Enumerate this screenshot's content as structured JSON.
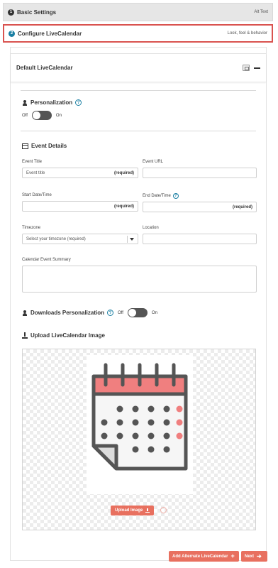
{
  "steps": [
    {
      "number": "1",
      "title": "Basic Settings",
      "right": "Alt Text"
    },
    {
      "number": "2",
      "title": "Configure LiveCalendar",
      "right": "Look, feel & behavior"
    }
  ],
  "card": {
    "title": "Default LiveCalendar"
  },
  "personalization": {
    "title": "Personalization",
    "help": "?",
    "off_label": "Off",
    "on_label": "On"
  },
  "event_details": {
    "title": "Event Details",
    "event_title": {
      "label": "Event Title",
      "placeholder": "Event title",
      "required": "(required)"
    },
    "event_url": {
      "label": "Event URL"
    },
    "start": {
      "label": "Start Date/Time",
      "required": "(required)"
    },
    "end": {
      "label": "End Date/Time",
      "help": "?",
      "required": "(required)"
    },
    "timezone": {
      "label": "Timezone",
      "value": "Select your timezone (required)"
    },
    "location": {
      "label": "Location"
    },
    "summary": {
      "label": "Calendar Event Summary"
    }
  },
  "downloads": {
    "title": "Downloads Personalization",
    "help": "?",
    "off_label": "Off",
    "on_label": "On"
  },
  "upload": {
    "title": "Upload LiveCalendar Image",
    "button": "Upload Image"
  },
  "footer": {
    "add_alternate": "Add Alternate LiveCalendar",
    "next": "Next"
  },
  "colors": {
    "accent": "#e8705f",
    "step_active_border": "#d9534f",
    "help": "#1a7fa3"
  },
  "icons": [
    "person-icon",
    "help-icon",
    "calendar-icon",
    "upload-icon",
    "copy-icon",
    "minus-icon",
    "plus-icon",
    "arrow-right-icon"
  ]
}
